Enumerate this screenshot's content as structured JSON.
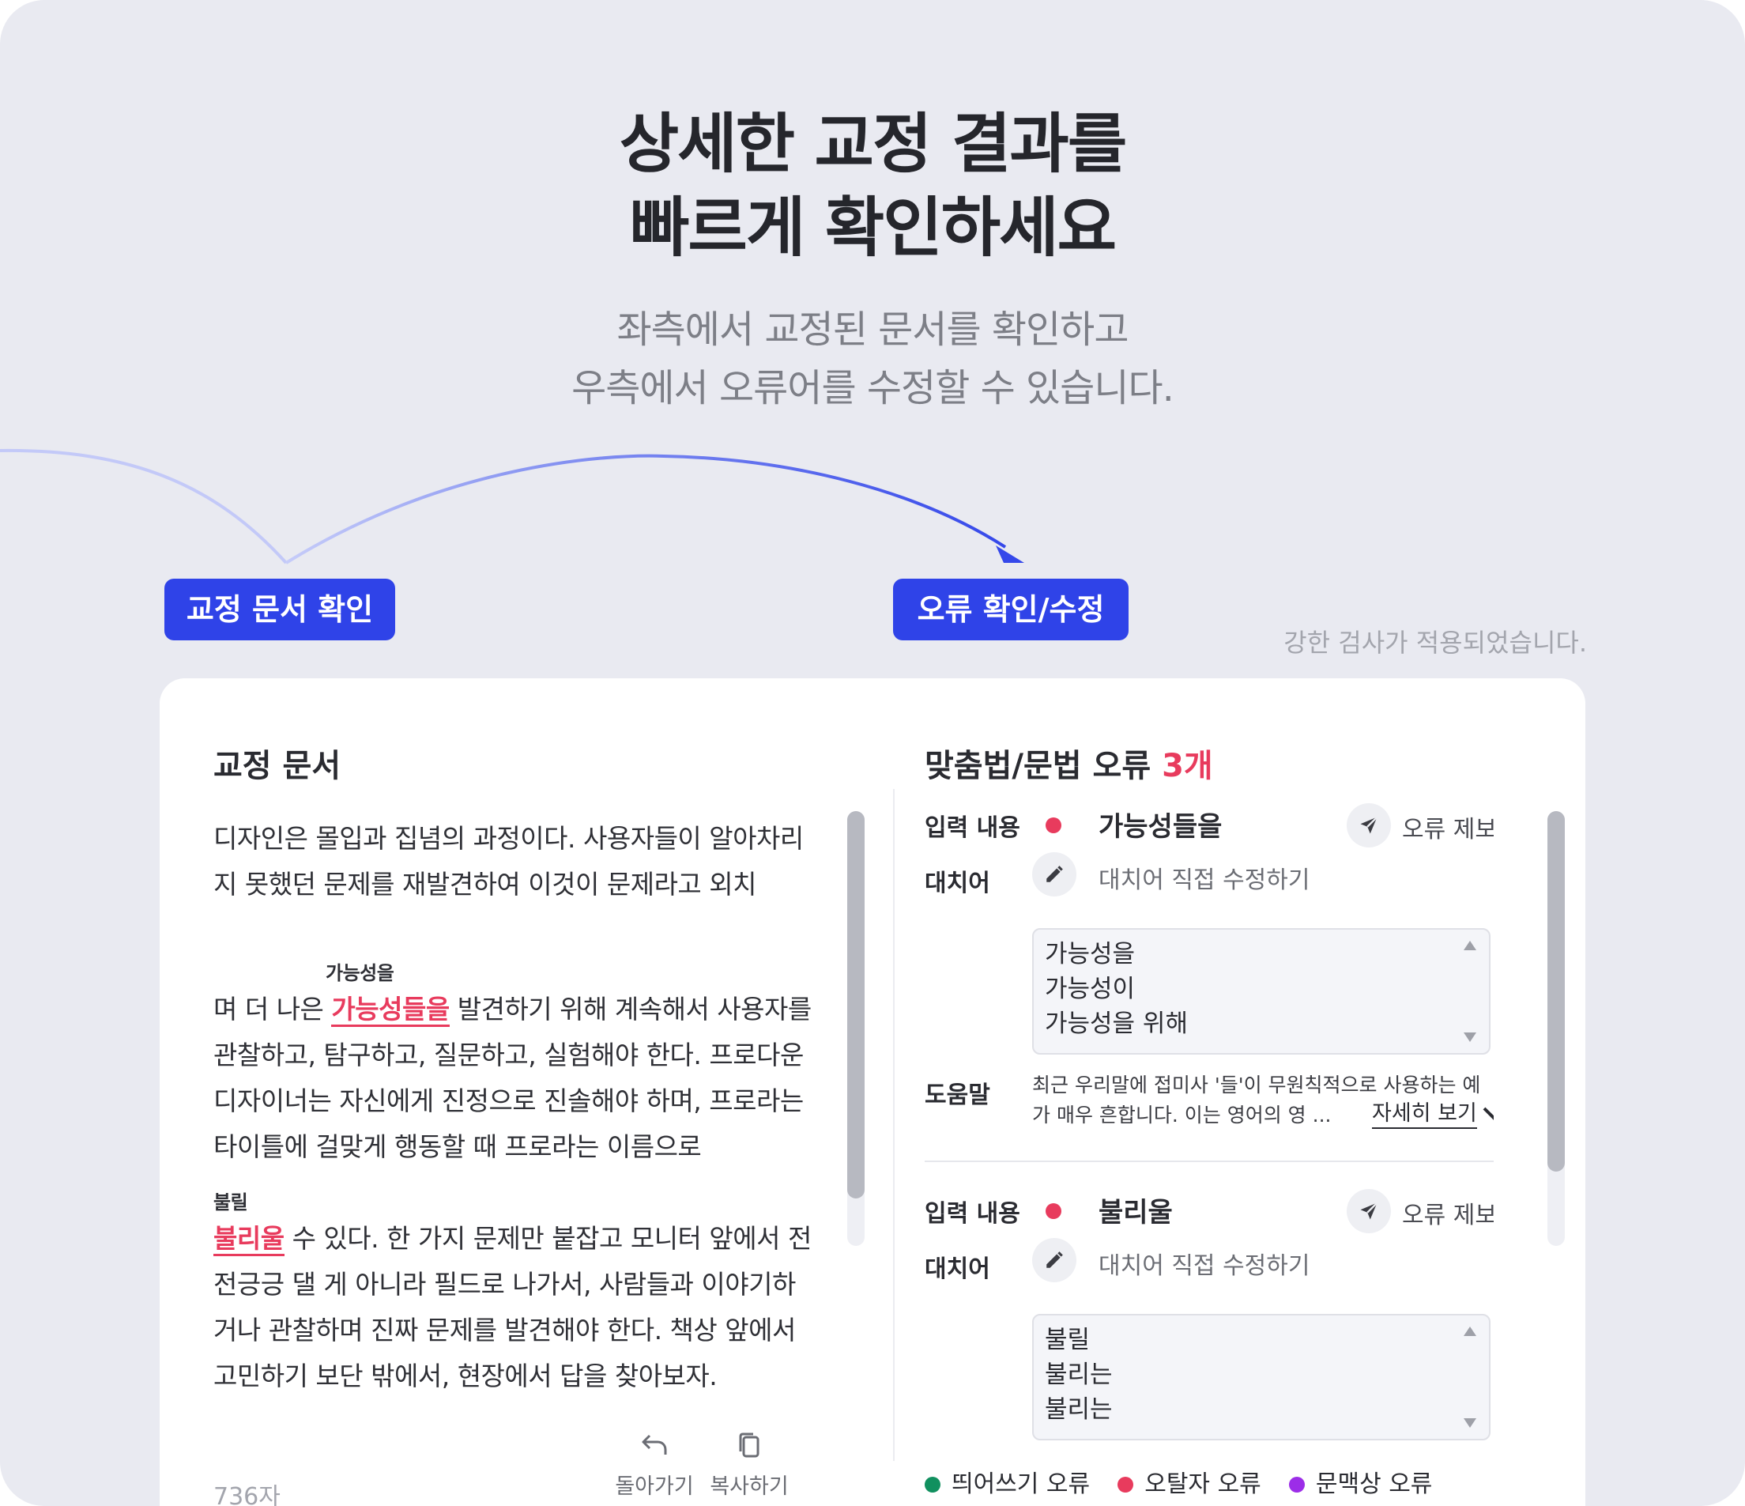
{
  "colors": {
    "background": "#e9eaf1",
    "accent": "#2f43e8",
    "error_red": "#e83b5d",
    "spacing_green": "#11905f",
    "context_purple": "#9c2de8"
  },
  "hero": {
    "title_line1": "상세한 교정 결과를",
    "title_line2": "빠르게 확인하세요",
    "subtitle_line1": "좌측에서 교정된 문서를 확인하고",
    "subtitle_line2": "우측에서 오류어를 수정할 수 있습니다."
  },
  "pills": {
    "left": "교정 문서 확인",
    "right": "오류 확인/수정"
  },
  "notice": "강한 검사가 적용되었습니다.",
  "document": {
    "title": "교정 문서",
    "line1": "디자인은 몰입과 집념의 과정이다. 사용자들이 알아차리",
    "line2": "지 못했던 문제를 재발견하여 이것이 문제라고 외치",
    "correction1_label": "가능성을",
    "line3_before": "며 더 나은 ",
    "line3_error": "가능성들을",
    "line3_after": " 발견하기 위해 계속해서 사용자를",
    "line4": "관찰하고, 탐구하고, 질문하고, 실험해야 한다. 프로다운",
    "line5": "디자이너는 자신에게 진정으로 진솔해야 하며, 프로라는",
    "line6": "타이틀에 걸맞게 행동할 때 프로라는 이름으로",
    "correction2_label": "불릴",
    "line7_error": "불리울",
    "line7_after": " 수 있다. 한 가지 문제만 붙잡고 모니터 앞에서 전",
    "line8": "전긍긍 댈 게 아니라 필드로 나가서, 사람들과 이야기하",
    "line9": "거나 관찰하며 진짜 문제를 발견해야 한다. 책상 앞에서",
    "line10": "고민하기 보단 밖에서, 현장에서 답을 찾아보자.",
    "char_count": "736자",
    "back_label": "돌아가기",
    "copy_label": "복사하기"
  },
  "errors_panel": {
    "title": "맞춤법/문법 오류",
    "count": "3개",
    "input_label": "입력 내용",
    "replacement_label": "대치어",
    "help_label": "도움말",
    "report_label": "오류 제보",
    "edit_placeholder": "대치어 직접 수정하기",
    "items": [
      {
        "input": "가능성들을",
        "options": [
          "가능성을",
          "가능성이",
          "가능성을 위해"
        ],
        "help_line1": "최근 우리말에 접미사 '들'이 무원칙적으로 사용하는 예",
        "help_line2": "가 매우 흔합니다. 이는 영어의 영 ...",
        "detail_link": "자세히 보기"
      },
      {
        "input": "불리울",
        "options": [
          "불릴",
          "불리는",
          "불리는"
        ]
      }
    ]
  },
  "legend": [
    {
      "label": "띄어쓰기 오류",
      "color": "#11905f"
    },
    {
      "label": "오탈자 오류",
      "color": "#e83b5d"
    },
    {
      "label": "문맥상 오류",
      "color": "#9c2de8"
    }
  ]
}
